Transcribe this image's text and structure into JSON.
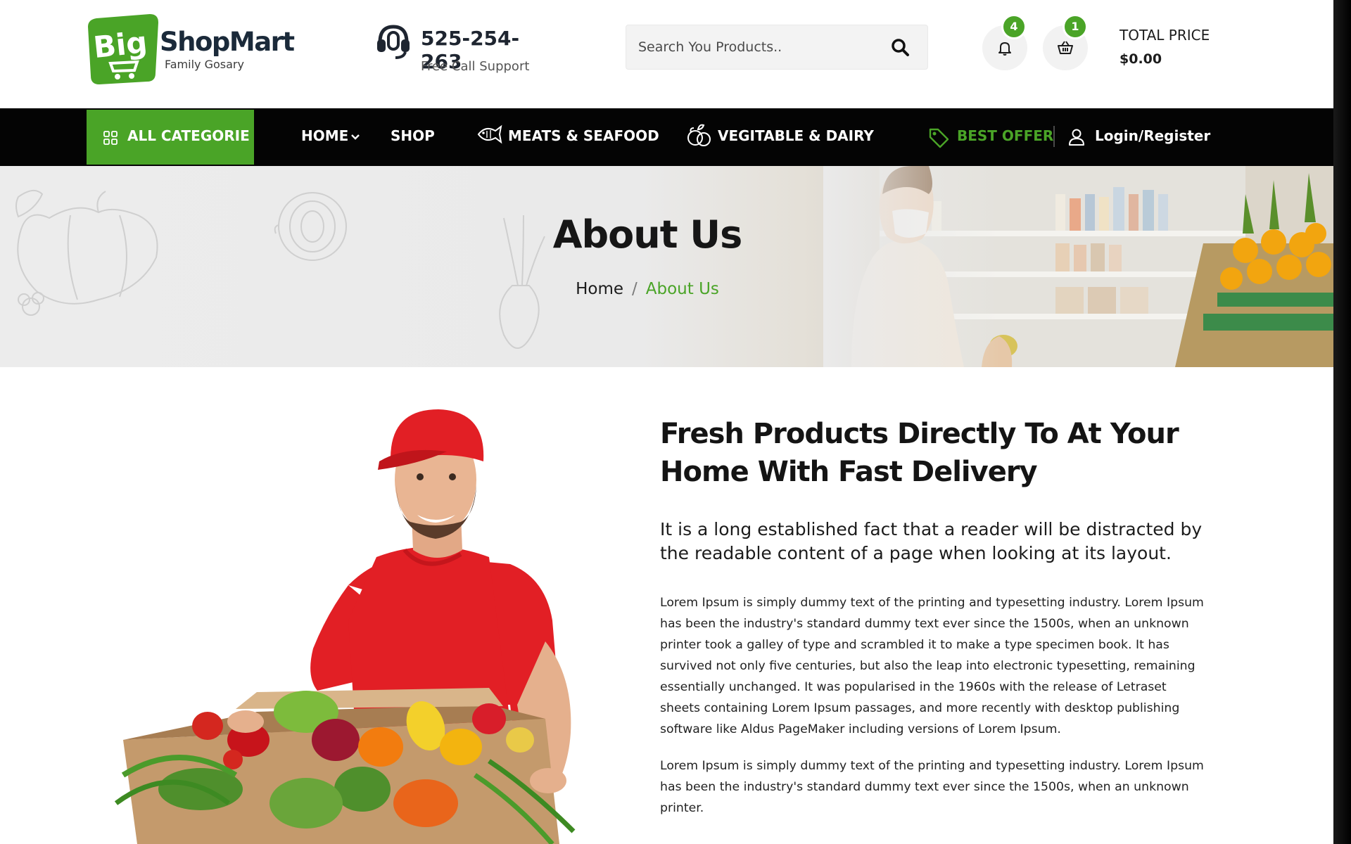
{
  "brand": {
    "logo_word": "Big",
    "name": "ShopMart",
    "tagline": "Family Gosary"
  },
  "support": {
    "phone": "525-254-263",
    "label": "Free Call Support"
  },
  "search": {
    "placeholder": "Search You Products.."
  },
  "header_icons": {
    "notifications_count": "4",
    "cart_count": "1",
    "total_label": "TOTAL PRICE",
    "total_value": "$0.00"
  },
  "nav": {
    "categories_label": "ALL CATEGORIE",
    "home": "HOME",
    "shop": "SHOP",
    "meats": "MEATS & SEAFOOD",
    "veg": "VEGITABLE & DAIRY",
    "offer": "BEST OFFER",
    "login": "Login/Register"
  },
  "hero": {
    "title": "About Us",
    "breadcrumb_home": "Home",
    "breadcrumb_separator": "/",
    "breadcrumb_current": "About Us"
  },
  "about": {
    "heading_line1": "Fresh Products Directly To At Your",
    "heading_line2": "Home With Fast Delivery",
    "lead_line1": "It is a long established fact that a reader will be distracted by",
    "lead_line2": "the readable content of a page when looking at its layout.",
    "paragraph1": "Lorem Ipsum is simply dummy text of the printing and typesetting industry. Lorem Ipsum has been the industry's standard dummy text ever since the 1500s, when an unknown printer took a galley of type and scrambled it to make a type specimen book. It has survived not only five centuries, but also the leap into electronic typesetting, remaining essentially unchanged. It was popularised in the 1960s with the release of Letraset sheets containing Lorem Ipsum passages, and more recently with desktop publishing software like Aldus PageMaker including versions of Lorem Ipsum.",
    "paragraph2": "Lorem Ipsum is simply dummy text of the printing and typesetting industry. Lorem Ipsum has been the industry's standard dummy text ever since the 1500s, when an unknown printer."
  },
  "colors": {
    "brand_green": "#4aa427",
    "nav_black": "#040404",
    "heading": "#141414"
  },
  "icons": {
    "support": "headset-icon",
    "search": "search-icon",
    "bell": "bell-icon",
    "cart": "basket-icon",
    "categories": "grid-icon",
    "dropdown": "chevron-down-icon",
    "meats": "fish-icon",
    "veg": "vegetables-icon",
    "offer": "tag-icon",
    "login": "user-icon"
  }
}
